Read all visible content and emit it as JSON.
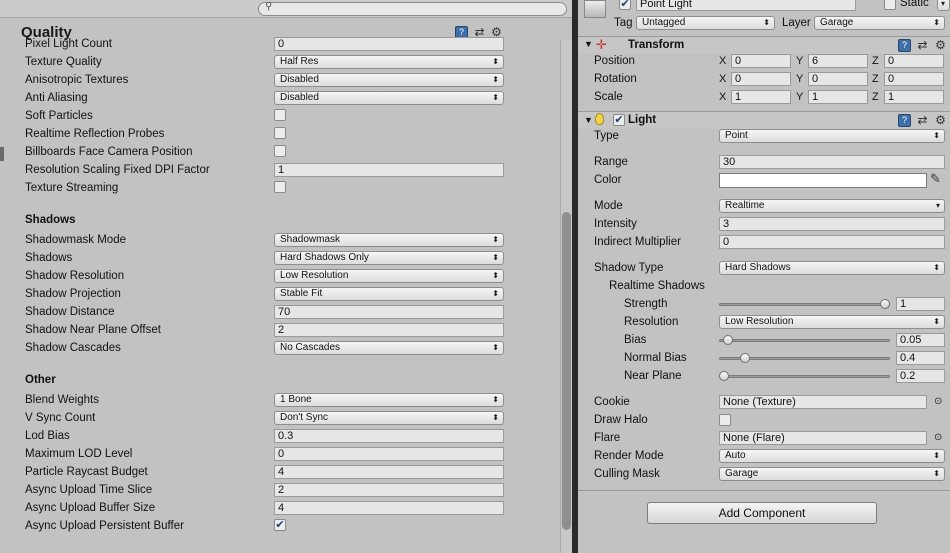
{
  "quality": {
    "title": "Quality",
    "rows": [
      {
        "label": "Pixel Light Count",
        "kind": "field",
        "value": "0"
      },
      {
        "label": "Texture Quality",
        "kind": "dropdown",
        "value": "Half Res"
      },
      {
        "label": "Anisotropic Textures",
        "kind": "dropdown",
        "value": "Disabled"
      },
      {
        "label": "Anti Aliasing",
        "kind": "dropdown",
        "value": "Disabled"
      },
      {
        "label": "Soft Particles",
        "kind": "check",
        "value": false
      },
      {
        "label": "Realtime Reflection Probes",
        "kind": "check",
        "value": false
      },
      {
        "label": "Billboards Face Camera Position",
        "kind": "check",
        "value": false
      },
      {
        "label": "Resolution Scaling Fixed DPI Factor",
        "kind": "field",
        "value": "1"
      },
      {
        "label": "Texture Streaming",
        "kind": "check",
        "value": false
      }
    ],
    "shadows_title": "Shadows",
    "shadows": [
      {
        "label": "Shadowmask Mode",
        "kind": "dropdown",
        "value": "Shadowmask"
      },
      {
        "label": "Shadows",
        "kind": "dropdown",
        "value": "Hard Shadows Only"
      },
      {
        "label": "Shadow Resolution",
        "kind": "dropdown",
        "value": "Low Resolution"
      },
      {
        "label": "Shadow Projection",
        "kind": "dropdown",
        "value": "Stable Fit"
      },
      {
        "label": "Shadow Distance",
        "kind": "field",
        "value": "70"
      },
      {
        "label": "Shadow Near Plane Offset",
        "kind": "field",
        "value": "2"
      },
      {
        "label": "Shadow Cascades",
        "kind": "dropdown",
        "value": "No Cascades"
      }
    ],
    "other_title": "Other",
    "other": [
      {
        "label": "Blend Weights",
        "kind": "dropdown",
        "value": "1 Bone"
      },
      {
        "label": "V Sync Count",
        "kind": "dropdown",
        "value": "Don't Sync"
      },
      {
        "label": "Lod Bias",
        "kind": "field",
        "value": "0.3"
      },
      {
        "label": "Maximum LOD Level",
        "kind": "field",
        "value": "0"
      },
      {
        "label": "Particle Raycast Budget",
        "kind": "field",
        "value": "4"
      },
      {
        "label": "Async Upload Time Slice",
        "kind": "field",
        "value": "2"
      },
      {
        "label": "Async Upload Buffer Size",
        "kind": "field",
        "value": "4"
      },
      {
        "label": "Async Upload Persistent Buffer",
        "kind": "check",
        "value": true
      }
    ],
    "search_glyph": "⚲"
  },
  "inspector": {
    "object_name": "Point Light",
    "static_label": "Static",
    "tag_label": "Tag",
    "tag_value": "Untagged",
    "layer_label": "Layer",
    "layer_value": "Garage",
    "transform": {
      "title": "Transform",
      "rows": [
        {
          "label": "Position",
          "x": "0",
          "y": "6",
          "z": "0"
        },
        {
          "label": "Rotation",
          "x": "0",
          "y": "0",
          "z": "0"
        },
        {
          "label": "Scale",
          "x": "1",
          "y": "1",
          "z": "1"
        }
      ],
      "axis_x": "X",
      "axis_y": "Y",
      "axis_z": "Z"
    },
    "light": {
      "title": "Light",
      "type_label": "Type",
      "type_value": "Point",
      "range_label": "Range",
      "range_value": "30",
      "color_label": "Color",
      "color_value": "#ffffff",
      "mode_label": "Mode",
      "mode_value": "Realtime",
      "intensity_label": "Intensity",
      "intensity_value": "3",
      "indirect_label": "Indirect Multiplier",
      "indirect_value": "0",
      "shadow_type_label": "Shadow Type",
      "shadow_type_value": "Hard Shadows",
      "realtime_shadows_label": "Realtime Shadows",
      "strength_label": "Strength",
      "strength_value": "1",
      "strength_fraction": 1.0,
      "resolution_label": "Resolution",
      "resolution_value": "Low Resolution",
      "bias_label": "Bias",
      "bias_value": "0.05",
      "bias_fraction": 0.025,
      "normal_bias_label": "Normal Bias",
      "normal_bias_value": "0.4",
      "normal_bias_fraction": 0.133,
      "near_plane_label": "Near Plane",
      "near_plane_value": "0.2",
      "near_plane_fraction": 0.0,
      "cookie_label": "Cookie",
      "cookie_value": "None (Texture)",
      "draw_halo_label": "Draw Halo",
      "flare_label": "Flare",
      "flare_value": "None (Flare)",
      "render_mode_label": "Render Mode",
      "render_mode_value": "Auto",
      "culling_mask_label": "Culling Mask",
      "culling_mask_value": "Garage"
    },
    "add_component_label": "Add Component"
  },
  "icons": {
    "dropdown_arrow": "⬍",
    "dropdown_arrow_small": "▾",
    "settings": "⚙",
    "layout": "⇄",
    "book": "?",
    "fold_down": "▼",
    "picker": "⊙",
    "eyedropper": "✎",
    "check": "✔",
    "bulb": "💡"
  }
}
